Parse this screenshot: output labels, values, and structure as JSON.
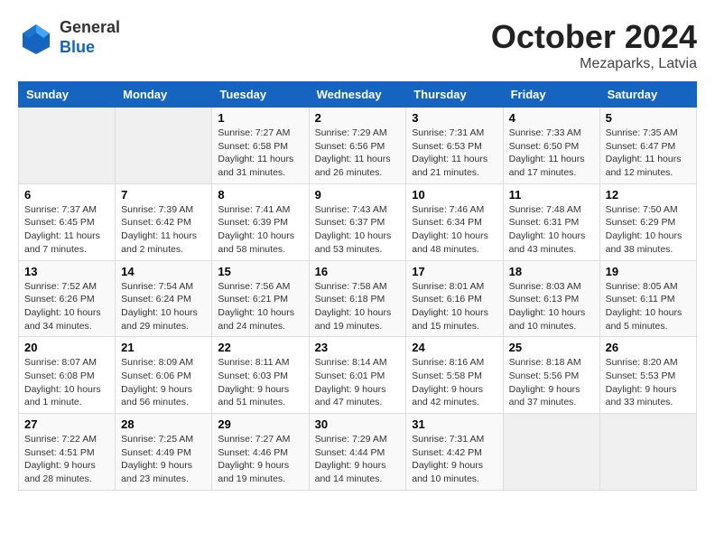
{
  "header": {
    "logo_general": "General",
    "logo_blue": "Blue",
    "month_title": "October 2024",
    "location": "Mezaparks, Latvia"
  },
  "weekdays": [
    "Sunday",
    "Monday",
    "Tuesday",
    "Wednesday",
    "Thursday",
    "Friday",
    "Saturday"
  ],
  "weeks": [
    [
      {
        "day": "",
        "info": ""
      },
      {
        "day": "",
        "info": ""
      },
      {
        "day": "1",
        "info": "Sunrise: 7:27 AM\nSunset: 6:58 PM\nDaylight: 11 hours and 31 minutes."
      },
      {
        "day": "2",
        "info": "Sunrise: 7:29 AM\nSunset: 6:56 PM\nDaylight: 11 hours and 26 minutes."
      },
      {
        "day": "3",
        "info": "Sunrise: 7:31 AM\nSunset: 6:53 PM\nDaylight: 11 hours and 21 minutes."
      },
      {
        "day": "4",
        "info": "Sunrise: 7:33 AM\nSunset: 6:50 PM\nDaylight: 11 hours and 17 minutes."
      },
      {
        "day": "5",
        "info": "Sunrise: 7:35 AM\nSunset: 6:47 PM\nDaylight: 11 hours and 12 minutes."
      }
    ],
    [
      {
        "day": "6",
        "info": "Sunrise: 7:37 AM\nSunset: 6:45 PM\nDaylight: 11 hours and 7 minutes."
      },
      {
        "day": "7",
        "info": "Sunrise: 7:39 AM\nSunset: 6:42 PM\nDaylight: 11 hours and 2 minutes."
      },
      {
        "day": "8",
        "info": "Sunrise: 7:41 AM\nSunset: 6:39 PM\nDaylight: 10 hours and 58 minutes."
      },
      {
        "day": "9",
        "info": "Sunrise: 7:43 AM\nSunset: 6:37 PM\nDaylight: 10 hours and 53 minutes."
      },
      {
        "day": "10",
        "info": "Sunrise: 7:46 AM\nSunset: 6:34 PM\nDaylight: 10 hours and 48 minutes."
      },
      {
        "day": "11",
        "info": "Sunrise: 7:48 AM\nSunset: 6:31 PM\nDaylight: 10 hours and 43 minutes."
      },
      {
        "day": "12",
        "info": "Sunrise: 7:50 AM\nSunset: 6:29 PM\nDaylight: 10 hours and 38 minutes."
      }
    ],
    [
      {
        "day": "13",
        "info": "Sunrise: 7:52 AM\nSunset: 6:26 PM\nDaylight: 10 hours and 34 minutes."
      },
      {
        "day": "14",
        "info": "Sunrise: 7:54 AM\nSunset: 6:24 PM\nDaylight: 10 hours and 29 minutes."
      },
      {
        "day": "15",
        "info": "Sunrise: 7:56 AM\nSunset: 6:21 PM\nDaylight: 10 hours and 24 minutes."
      },
      {
        "day": "16",
        "info": "Sunrise: 7:58 AM\nSunset: 6:18 PM\nDaylight: 10 hours and 19 minutes."
      },
      {
        "day": "17",
        "info": "Sunrise: 8:01 AM\nSunset: 6:16 PM\nDaylight: 10 hours and 15 minutes."
      },
      {
        "day": "18",
        "info": "Sunrise: 8:03 AM\nSunset: 6:13 PM\nDaylight: 10 hours and 10 minutes."
      },
      {
        "day": "19",
        "info": "Sunrise: 8:05 AM\nSunset: 6:11 PM\nDaylight: 10 hours and 5 minutes."
      }
    ],
    [
      {
        "day": "20",
        "info": "Sunrise: 8:07 AM\nSunset: 6:08 PM\nDaylight: 10 hours and 1 minute."
      },
      {
        "day": "21",
        "info": "Sunrise: 8:09 AM\nSunset: 6:06 PM\nDaylight: 9 hours and 56 minutes."
      },
      {
        "day": "22",
        "info": "Sunrise: 8:11 AM\nSunset: 6:03 PM\nDaylight: 9 hours and 51 minutes."
      },
      {
        "day": "23",
        "info": "Sunrise: 8:14 AM\nSunset: 6:01 PM\nDaylight: 9 hours and 47 minutes."
      },
      {
        "day": "24",
        "info": "Sunrise: 8:16 AM\nSunset: 5:58 PM\nDaylight: 9 hours and 42 minutes."
      },
      {
        "day": "25",
        "info": "Sunrise: 8:18 AM\nSunset: 5:56 PM\nDaylight: 9 hours and 37 minutes."
      },
      {
        "day": "26",
        "info": "Sunrise: 8:20 AM\nSunset: 5:53 PM\nDaylight: 9 hours and 33 minutes."
      }
    ],
    [
      {
        "day": "27",
        "info": "Sunrise: 7:22 AM\nSunset: 4:51 PM\nDaylight: 9 hours and 28 minutes."
      },
      {
        "day": "28",
        "info": "Sunrise: 7:25 AM\nSunset: 4:49 PM\nDaylight: 9 hours and 23 minutes."
      },
      {
        "day": "29",
        "info": "Sunrise: 7:27 AM\nSunset: 4:46 PM\nDaylight: 9 hours and 19 minutes."
      },
      {
        "day": "30",
        "info": "Sunrise: 7:29 AM\nSunset: 4:44 PM\nDaylight: 9 hours and 14 minutes."
      },
      {
        "day": "31",
        "info": "Sunrise: 7:31 AM\nSunset: 4:42 PM\nDaylight: 9 hours and 10 minutes."
      },
      {
        "day": "",
        "info": ""
      },
      {
        "day": "",
        "info": ""
      }
    ]
  ]
}
